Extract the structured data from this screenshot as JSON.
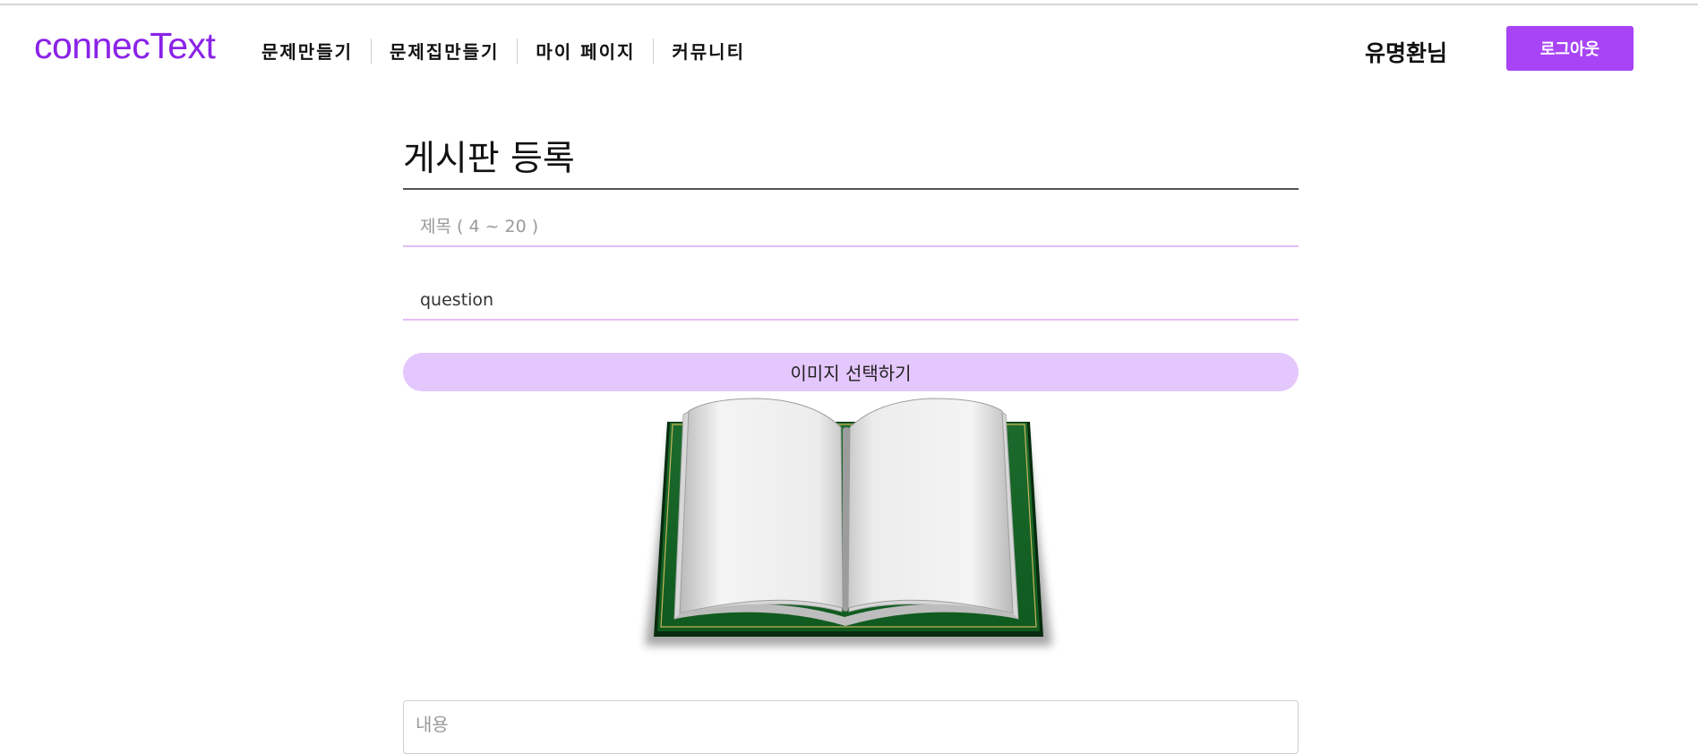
{
  "header": {
    "logo": "connecText",
    "nav": [
      {
        "label": "문제만들기"
      },
      {
        "label": "문제집만들기"
      },
      {
        "label": "마이 페이지"
      },
      {
        "label": "커뮤니티"
      }
    ],
    "user_name": "유명환님",
    "logout_label": "로그아웃"
  },
  "form": {
    "page_title": "게시판 등록",
    "title_field": {
      "placeholder": "제목 ( 4 ~ 20 )",
      "value": ""
    },
    "category_field": {
      "value": "question"
    },
    "image_button_label": "이미지 선택하기",
    "preview_image": "open-book-icon",
    "content_field": {
      "placeholder": "내용",
      "value": ""
    }
  },
  "colors": {
    "brand": "#8b22e8",
    "logout_button": "#a844f5",
    "image_button": "#e4c7fc",
    "field_underline": "#e3bdf7"
  }
}
